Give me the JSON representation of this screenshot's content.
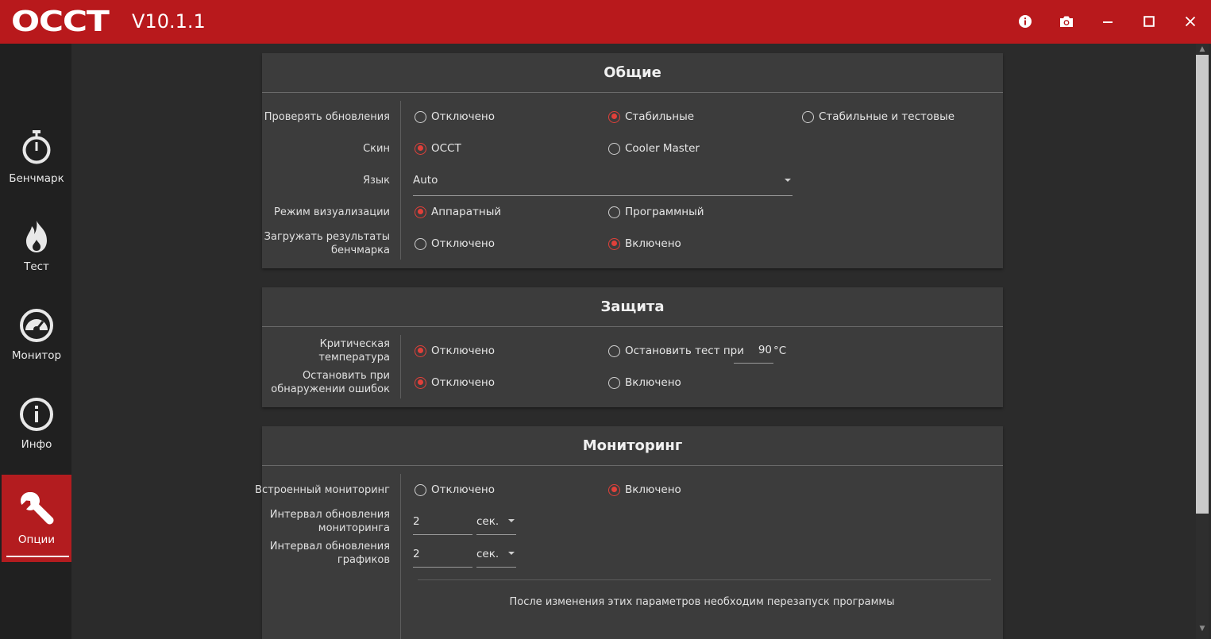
{
  "app": {
    "logo": "OCCT",
    "version": "V10.1.1"
  },
  "window_controls": [
    "info-icon",
    "camera-icon",
    "minimize-icon",
    "maximize-icon",
    "close-icon"
  ],
  "sidebar": {
    "items": [
      {
        "label": "Бенчмарк",
        "icon": "stopwatch-icon",
        "active": false
      },
      {
        "label": "Тест",
        "icon": "flame-icon",
        "active": false
      },
      {
        "label": "Монитор",
        "icon": "gauge-icon",
        "active": false
      },
      {
        "label": "Инфо",
        "icon": "info-circle-icon",
        "active": false
      },
      {
        "label": "Опции",
        "icon": "wrench-icon",
        "active": true
      }
    ]
  },
  "general": {
    "title": "Общие",
    "check_updates": {
      "label": "Проверять обновления",
      "options": [
        "Отключено",
        "Стабильные",
        "Стабильные и тестовые"
      ],
      "selected": "Стабильные"
    },
    "skin": {
      "label": "Скин",
      "options": [
        "OCCT",
        "Cooler Master"
      ],
      "selected": "OCCT"
    },
    "language": {
      "label": "Язык",
      "value": "Auto"
    },
    "render_mode": {
      "label": "Режим визуализации",
      "options": [
        "Аппаратный",
        "Программный"
      ],
      "selected": "Аппаратный"
    },
    "upload_results": {
      "label": "Загружать результаты бенчмарка",
      "options": [
        "Отключено",
        "Включено"
      ],
      "selected": "Включено"
    }
  },
  "protection": {
    "title": "Защита",
    "critical_temp": {
      "label": "Критическая температура",
      "options": [
        "Отключено",
        "Остановить тест при"
      ],
      "selected": "Отключено",
      "temp_value": "90",
      "temp_unit": "°C"
    },
    "stop_on_error": {
      "label": "Остановить при обнаружении ошибок",
      "options": [
        "Отключено",
        "Включено"
      ],
      "selected": "Отключено"
    }
  },
  "monitoring": {
    "title": "Мониторинг",
    "builtin": {
      "label": "Встроенный мониторинг",
      "options": [
        "Отключено",
        "Включено"
      ],
      "selected": "Включено"
    },
    "refresh_interval": {
      "label": "Интервал обновления мониторинга",
      "value": "2",
      "unit": "сек."
    },
    "graph_interval": {
      "label": "Интервал обновления графиков",
      "value": "2",
      "unit": "сек."
    },
    "restart_note": "После изменения этих параметров необходим перезапуск программы"
  },
  "colors": {
    "titlebar": "#b8191c",
    "accent": "#e0403a",
    "panel": "#3c3c3c",
    "background": "#2b2b2b",
    "sidebar": "#202020"
  }
}
